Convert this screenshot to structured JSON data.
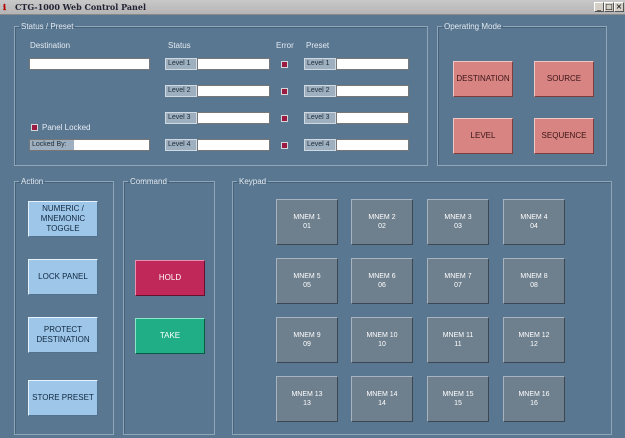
{
  "window": {
    "title": "CTG-1000 Web Control Panel",
    "controls": [
      "_",
      "□",
      "×"
    ]
  },
  "status_preset": {
    "legend": "Status / Preset",
    "destination_label": "Destination",
    "status_label": "Status",
    "error_label": "Error",
    "preset_label": "Preset",
    "destination_value": "",
    "status_levels": [
      "Level 1",
      "Level 2",
      "Level 3",
      "Level 4"
    ],
    "preset_levels": [
      "Level 1",
      "Level 2",
      "Level 3",
      "Level 4"
    ],
    "panel_locked_label": "Panel Locked",
    "locked_by_label": "Locked By:",
    "locked_by_value": ""
  },
  "operating_mode": {
    "legend": "Operating Mode",
    "buttons": [
      "DESTINATION",
      "SOURCE",
      "LEVEL",
      "SEQUENCE"
    ]
  },
  "action": {
    "legend": "Action",
    "buttons": [
      "NUMERIC /\nMNEMONIC\nTOGGLE",
      "LOCK PANEL",
      "PROTECT\nDESTINATION",
      "STORE PRESET"
    ]
  },
  "command": {
    "legend": "Command",
    "hold": "HOLD",
    "take": "TAKE"
  },
  "keypad": {
    "legend": "Keypad",
    "keys": [
      {
        "name": "MNEM 1",
        "code": "01"
      },
      {
        "name": "MNEM 2",
        "code": "02"
      },
      {
        "name": "MNEM 3",
        "code": "03"
      },
      {
        "name": "MNEM 4",
        "code": "04"
      },
      {
        "name": "MNEM 5",
        "code": "05"
      },
      {
        "name": "MNEM 6",
        "code": "06"
      },
      {
        "name": "MNEM 7",
        "code": "07"
      },
      {
        "name": "MNEM 8",
        "code": "08"
      },
      {
        "name": "MNEM 9",
        "code": "09"
      },
      {
        "name": "MNEM 10",
        "code": "10"
      },
      {
        "name": "MNEM 11",
        "code": "11"
      },
      {
        "name": "MNEM 12",
        "code": "12"
      },
      {
        "name": "MNEM 13",
        "code": "13"
      },
      {
        "name": "MNEM 14",
        "code": "14"
      },
      {
        "name": "MNEM 15",
        "code": "15"
      },
      {
        "name": "MNEM 16",
        "code": "16"
      }
    ]
  },
  "colors": {
    "background": "#5a7791",
    "mode_button": "#d88483",
    "action_button": "#9ec6e8",
    "hold": "#bf2858",
    "take": "#1fae86",
    "key": "#6e7f8d",
    "error_indicator": "#9a1c45"
  }
}
